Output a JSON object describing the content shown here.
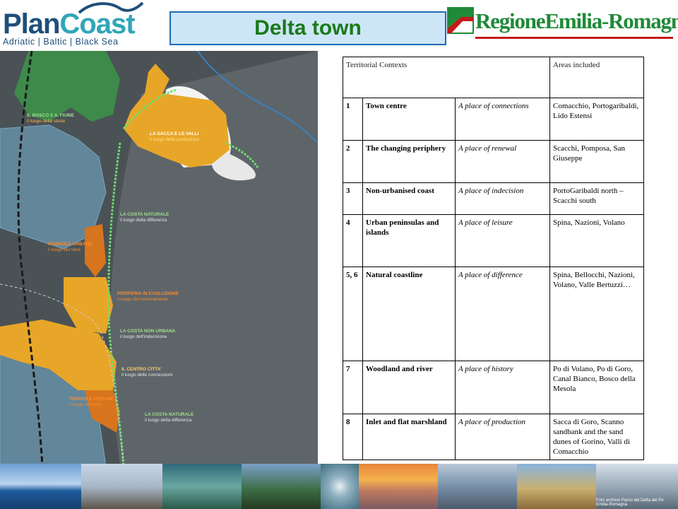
{
  "header": {
    "logo_plan": "Plan",
    "logo_coast": "Coast",
    "logo_tagline": "Adriatic | Baltic | Black Sea",
    "title": "Delta town",
    "region_logo": "RegioneEmilia-Romagna"
  },
  "map": {
    "labels": [
      {
        "title": "IL BOSCO E IL FIUME",
        "sub": "il luogo della storia"
      },
      {
        "title": "LA SACCA E LE VALLI",
        "sub": "il luogo della produzione"
      },
      {
        "title": "LA COSTA NATURALE",
        "sub": "il luogo della differenza"
      },
      {
        "title": "PENISOLE URBANE",
        "sub": "il luogo del loisir"
      },
      {
        "title": "PERIFERIA IN EVOLUZIONE",
        "sub": "il luogo del rinnovamento"
      },
      {
        "title": "LA COSTA NON URBANA",
        "sub": "il luogo dell'indecisione"
      },
      {
        "title": "IL CENTRO CITTA'",
        "sub": "il luogo delle connessioni"
      },
      {
        "title": "PENISOLE URBANE",
        "sub": "il luogo del loisir"
      },
      {
        "title": "LA COSTA NATURALE",
        "sub": "il luogo della differenza"
      }
    ]
  },
  "table": {
    "headers": {
      "contexts": "Territorial Contexts",
      "areas": "Areas included"
    },
    "rows": [
      {
        "num": "1",
        "name": "Town centre",
        "place": "A place of connections",
        "areas": "Comacchio, Portogaribaldi, Lido Estensi"
      },
      {
        "num": "2",
        "name": "The changing periphery",
        "place": "A place of renewal",
        "areas": "Scacchi, Pomposa, San Giuseppe"
      },
      {
        "num": "3",
        "name": "Non-urbanised coast",
        "place": "A place of indecision",
        "areas": "PortoGaribaldi north – Scacchi south"
      },
      {
        "num": "4",
        "name": "Urban peninsulas and islands",
        "place": "A place of leisure",
        "areas": "Spina, Nazioni, Volano"
      },
      {
        "num": "5, 6",
        "name": "Natural coastline",
        "place": "A place of difference",
        "areas": "Spina, Bellocchi, Nazioni, Volano, Valle Bertuzzi…"
      },
      {
        "num": "7",
        "name": "Woodland and river",
        "place": "A place of history",
        "areas": "Po di Volano, Po di Goro, Canal Bianco, Bosco della Mesola"
      },
      {
        "num": "8",
        "name": "Inlet and flat marshland",
        "place": "A place of production",
        "areas": "Sacca di Goro, Scanno sandbank and the sand dunes of Gorino, Valli di Comacchio"
      }
    ]
  },
  "footer": {
    "credit": "Foto archivio Parco del Delta del Po Emilia-Romagna"
  }
}
